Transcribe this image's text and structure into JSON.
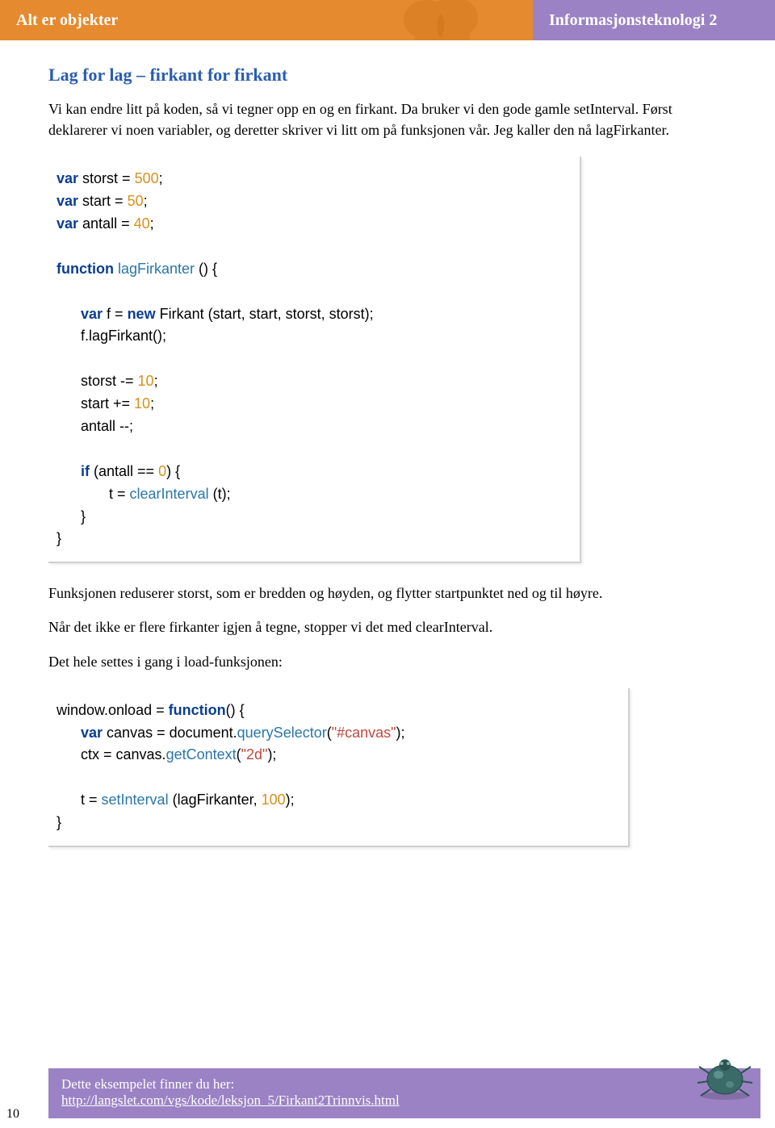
{
  "header": {
    "left": "Alt er objekter",
    "right": "Informasjonsteknologi 2"
  },
  "section_title": "Lag for lag – firkant for firkant",
  "para1": "Vi kan endre litt på koden, så vi tegner opp en og en firkant. Da bruker vi den gode gamle setInterval. Først deklarerer vi noen variabler, og deretter skriver vi litt om på funksjonen vår. Jeg kaller den nå lagFirkanter.",
  "para2": "Funksjonen reduserer storst, som er bredden og høyden, og flytter startpunktet ned og til høyre.",
  "para3": "Når det ikke er flere firkanter igjen å tegne, stopper vi det med clearInterval.",
  "para4": "Det hele settes i gang i load-funksjonen:",
  "code1": {
    "l1_var": "var",
    "l1_id": " storst ",
    "l1_eq": "= ",
    "l1_num": "500",
    "l1_end": ";",
    "l2_var": "var",
    "l2_id": " start ",
    "l2_eq": "= ",
    "l2_num": "50",
    "l2_end": ";",
    "l3_var": "var",
    "l3_id": " antall ",
    "l3_eq": "= ",
    "l3_num": "40",
    "l3_end": ";",
    "l5_fn": "function",
    "l5_name": " lagFirkanter ",
    "l5_paren": "() {",
    "l7_var": "var",
    "l7_rest1": " f = ",
    "l7_new": "new",
    "l7_rest2": " Firkant (start, start, storst, storst);",
    "l8": "      f.lagFirkant();",
    "l10a": "      storst -= ",
    "l10b": "10",
    "l10c": ";",
    "l11a": "      start += ",
    "l11b": "10",
    "l11c": ";",
    "l12": "      antall --;",
    "l14_if": "if",
    "l14_rest": " (antall == ",
    "l14_zero": "0",
    "l14_close": ") {",
    "l15a": "             t = ",
    "l15b": "clearInterval",
    "l15c": " (t);",
    "l16": "      }",
    "l17": "}"
  },
  "code2": {
    "l1a": "window.onload = ",
    "l1b": "function",
    "l1c": "() {",
    "l2_var": "var",
    "l2a": " canvas = document.",
    "l2b": "querySelector",
    "l2c": "(",
    "l2d": "\"#canvas\"",
    "l2e": ");",
    "l3a": "      ctx = canvas.",
    "l3b": "getContext",
    "l3c": "(",
    "l3d": "\"2d\"",
    "l3e": ");",
    "l5a": "      t = ",
    "l5b": "setInterval",
    "l5c": " (lagFirkanter, ",
    "l5d": "100",
    "l5e": ");",
    "l6": "}"
  },
  "footer": {
    "text": "Dette eksempelet finner du her:",
    "link": "http://langslet.com/vgs/kode/leksjon_5/Firkant2Trinnvis.html"
  },
  "page_number": "10"
}
